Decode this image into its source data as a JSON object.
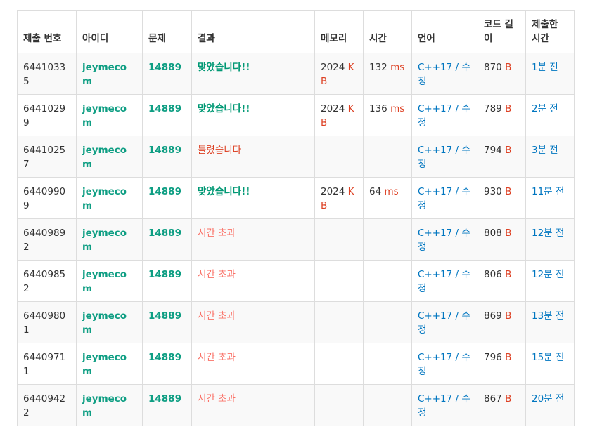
{
  "columns": {
    "submission_id": "제출 번호",
    "user": "아이디",
    "problem": "문제",
    "result": "결과",
    "memory": "메모리",
    "time": "시간",
    "language": "언어",
    "code_length": "코드 길이",
    "submitted_at": "제출한 시간"
  },
  "units": {
    "memory": "KB",
    "time": "ms",
    "length": "B"
  },
  "edit_separator": " / ",
  "edit_label": "수정",
  "rows": [
    {
      "id": "64410335",
      "user": "jeymecom",
      "problem": "14889",
      "result": "맞았습니다!!",
      "result_type": "ac",
      "memory": "2024",
      "time": "132",
      "language": "C++17",
      "length": "870",
      "ago": "1분 전"
    },
    {
      "id": "64410299",
      "user": "jeymecom",
      "problem": "14889",
      "result": "맞았습니다!!",
      "result_type": "ac",
      "memory": "2024",
      "time": "136",
      "language": "C++17",
      "length": "789",
      "ago": "2분 전"
    },
    {
      "id": "64410257",
      "user": "jeymecom",
      "problem": "14889",
      "result": "틀렸습니다",
      "result_type": "wa",
      "memory": "",
      "time": "",
      "language": "C++17",
      "length": "794",
      "ago": "3분 전"
    },
    {
      "id": "64409909",
      "user": "jeymecom",
      "problem": "14889",
      "result": "맞았습니다!!",
      "result_type": "ac",
      "memory": "2024",
      "time": "64",
      "language": "C++17",
      "length": "930",
      "ago": "11분 전"
    },
    {
      "id": "64409892",
      "user": "jeymecom",
      "problem": "14889",
      "result": "시간 초과",
      "result_type": "tle",
      "memory": "",
      "time": "",
      "language": "C++17",
      "length": "808",
      "ago": "12분 전"
    },
    {
      "id": "64409852",
      "user": "jeymecom",
      "problem": "14889",
      "result": "시간 초과",
      "result_type": "tle",
      "memory": "",
      "time": "",
      "language": "C++17",
      "length": "806",
      "ago": "12분 전"
    },
    {
      "id": "64409801",
      "user": "jeymecom",
      "problem": "14889",
      "result": "시간 초과",
      "result_type": "tle",
      "memory": "",
      "time": "",
      "language": "C++17",
      "length": "869",
      "ago": "13분 전"
    },
    {
      "id": "64409711",
      "user": "jeymecom",
      "problem": "14889",
      "result": "시간 초과",
      "result_type": "tle",
      "memory": "",
      "time": "",
      "language": "C++17",
      "length": "796",
      "ago": "15분 전"
    },
    {
      "id": "64409422",
      "user": "jeymecom",
      "problem": "14889",
      "result": "시간 초과",
      "result_type": "tle",
      "memory": "",
      "time": "",
      "language": "C++17",
      "length": "867",
      "ago": "20분 전"
    }
  ],
  "colors": {
    "link_green": "#0e9e83",
    "accepted": "#009874",
    "wrong_answer": "#dd4124",
    "time_limit": "#fa7268",
    "unit_red": "#dd4124",
    "link_blue": "#0076c0"
  }
}
